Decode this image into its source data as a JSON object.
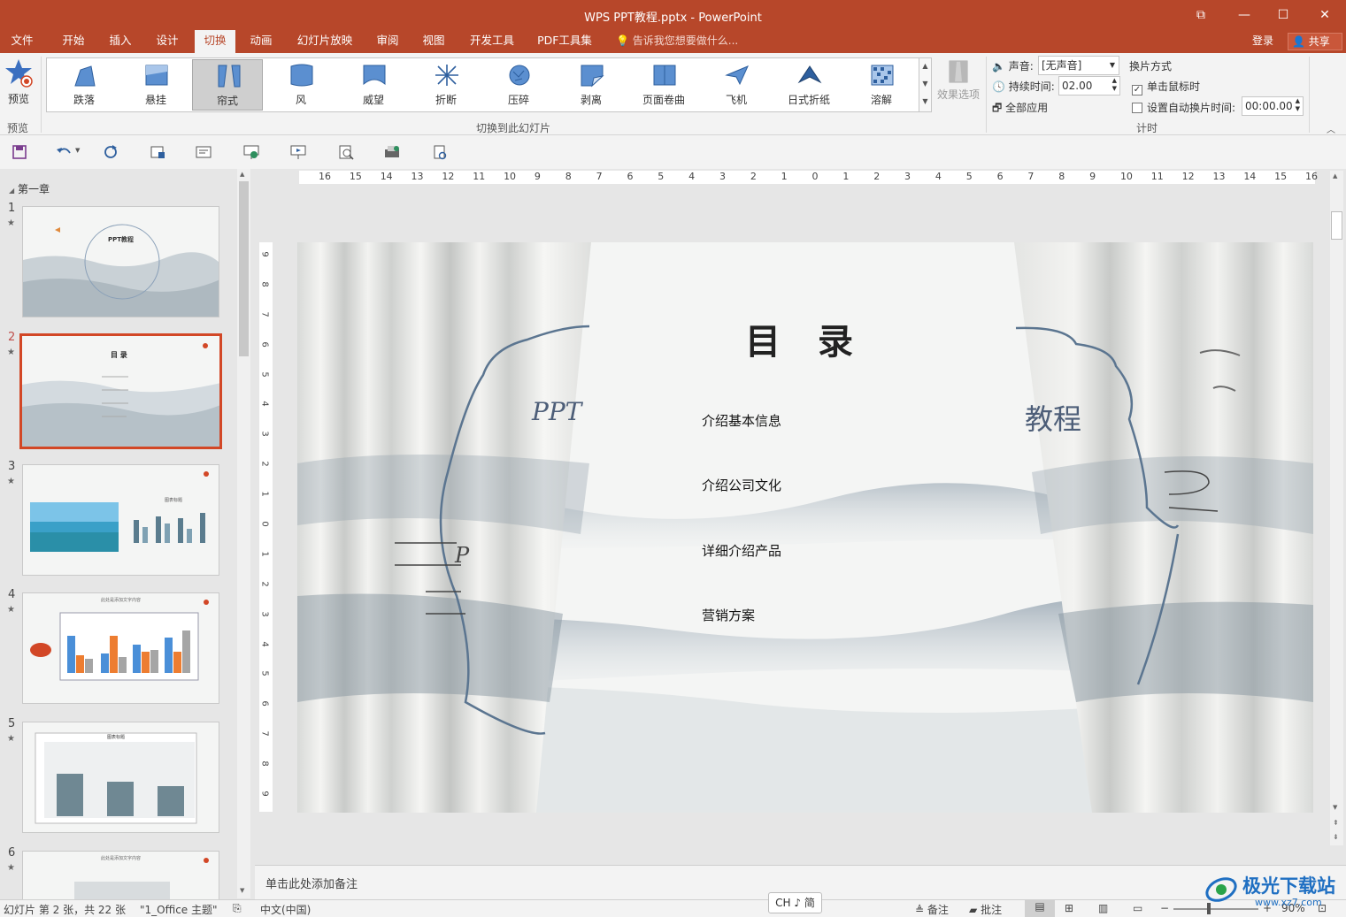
{
  "window": {
    "title": "WPS PPT教程.pptx - PowerPoint",
    "controls": {
      "restore_ribbon": "⧉",
      "minimize": "—",
      "maximize": "☐",
      "close": "✕"
    }
  },
  "menu": {
    "tabs": [
      "文件",
      "开始",
      "插入",
      "设计",
      "切换",
      "动画",
      "幻灯片放映",
      "审阅",
      "视图",
      "开发工具",
      "PDF工具集"
    ],
    "active_tab": "切换",
    "tell_me": "告诉我您想要做什么...",
    "login": "登录",
    "share": "共享"
  },
  "ribbon": {
    "preview_label": "预览",
    "preview_group": "预览",
    "transitions": [
      "跌落",
      "悬挂",
      "帘式",
      "风",
      "威望",
      "折断",
      "压碎",
      "剥离",
      "页面卷曲",
      "飞机",
      "日式折纸",
      "溶解"
    ],
    "selected_transition": "帘式",
    "transition_group": "切换到此幻灯片",
    "effect_options": "效果选项",
    "sound_label": "声音:",
    "sound_value": "[无声音]",
    "duration_label": "持续时间:",
    "duration_value": "02.00",
    "apply_all": "全部应用",
    "advance_title": "换片方式",
    "on_click_label": "单击鼠标时",
    "on_click_checked": true,
    "auto_after_label": "设置自动换片时间:",
    "auto_after_checked": false,
    "auto_after_value": "00:00.00",
    "timing_group": "计时"
  },
  "thumbnails": {
    "section": "第一章",
    "slides": [
      {
        "num": "1",
        "title": "PPT教程"
      },
      {
        "num": "2",
        "title": "目 录"
      },
      {
        "num": "3",
        "title": "图表标题"
      },
      {
        "num": "4",
        "title": "此处是添加文字内容"
      },
      {
        "num": "5",
        "title": "图表标题"
      },
      {
        "num": "6",
        "title": "此处是添加文字内容"
      }
    ],
    "active_slide": "2"
  },
  "rulers": {
    "horizontal": [
      "16",
      "15",
      "14",
      "13",
      "12",
      "11",
      "10",
      "9",
      "8",
      "7",
      "6",
      "5",
      "4",
      "3",
      "2",
      "1",
      "0",
      "1",
      "2",
      "3",
      "4",
      "5",
      "6",
      "7",
      "8",
      "9",
      "10",
      "11",
      "12",
      "13",
      "14",
      "15",
      "16"
    ],
    "vertical": [
      "9",
      "8",
      "7",
      "6",
      "5",
      "4",
      "3",
      "2",
      "1",
      "0",
      "1",
      "2",
      "3",
      "4",
      "5",
      "6",
      "7",
      "8",
      "9"
    ]
  },
  "slide": {
    "title": "目 录",
    "items": [
      "介绍基本信息",
      "介绍公司文化",
      "详细介绍产品",
      "营销方案"
    ],
    "curtain_left_text": "PPT",
    "curtain_right_text": "教程",
    "curtain_left_small": "P"
  },
  "notes_placeholder": "单击此处添加备注",
  "status": {
    "slide_info": "幻灯片 第 2 张，共 22 张",
    "theme": "\"1_Office 主题\"",
    "language": "中文(中国)",
    "notes": "备注",
    "comments": "批注",
    "zoom": "90%",
    "ime": "CH ♪ 简"
  },
  "watermark": {
    "text": "极光下载站",
    "url": "www.xz7.com"
  },
  "colors": {
    "accent": "#b7472a",
    "selection": "#d24726"
  }
}
